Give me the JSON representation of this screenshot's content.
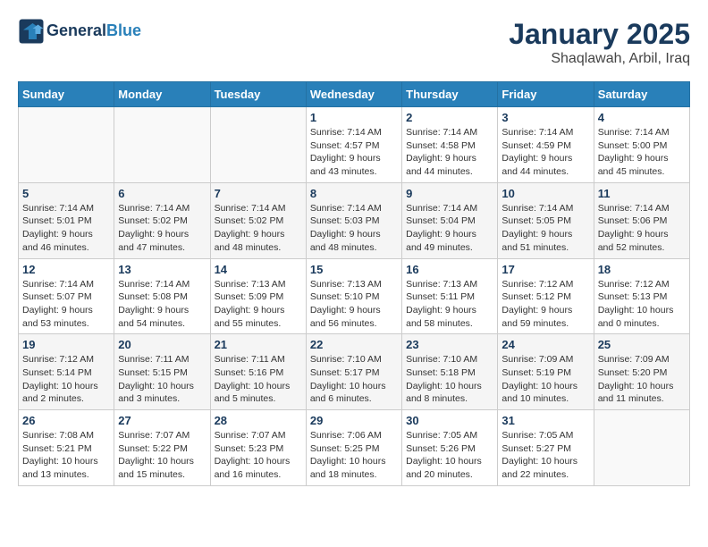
{
  "header": {
    "logo_line1": "General",
    "logo_line2": "Blue",
    "title": "January 2025",
    "subtitle": "Shaqlawah, Arbil, Iraq"
  },
  "weekdays": [
    "Sunday",
    "Monday",
    "Tuesday",
    "Wednesday",
    "Thursday",
    "Friday",
    "Saturday"
  ],
  "weeks": [
    [
      {
        "day": "",
        "info": ""
      },
      {
        "day": "",
        "info": ""
      },
      {
        "day": "",
        "info": ""
      },
      {
        "day": "1",
        "info": "Sunrise: 7:14 AM\nSunset: 4:57 PM\nDaylight: 9 hours and 43 minutes."
      },
      {
        "day": "2",
        "info": "Sunrise: 7:14 AM\nSunset: 4:58 PM\nDaylight: 9 hours and 44 minutes."
      },
      {
        "day": "3",
        "info": "Sunrise: 7:14 AM\nSunset: 4:59 PM\nDaylight: 9 hours and 44 minutes."
      },
      {
        "day": "4",
        "info": "Sunrise: 7:14 AM\nSunset: 5:00 PM\nDaylight: 9 hours and 45 minutes."
      }
    ],
    [
      {
        "day": "5",
        "info": "Sunrise: 7:14 AM\nSunset: 5:01 PM\nDaylight: 9 hours and 46 minutes."
      },
      {
        "day": "6",
        "info": "Sunrise: 7:14 AM\nSunset: 5:02 PM\nDaylight: 9 hours and 47 minutes."
      },
      {
        "day": "7",
        "info": "Sunrise: 7:14 AM\nSunset: 5:02 PM\nDaylight: 9 hours and 48 minutes."
      },
      {
        "day": "8",
        "info": "Sunrise: 7:14 AM\nSunset: 5:03 PM\nDaylight: 9 hours and 48 minutes."
      },
      {
        "day": "9",
        "info": "Sunrise: 7:14 AM\nSunset: 5:04 PM\nDaylight: 9 hours and 49 minutes."
      },
      {
        "day": "10",
        "info": "Sunrise: 7:14 AM\nSunset: 5:05 PM\nDaylight: 9 hours and 51 minutes."
      },
      {
        "day": "11",
        "info": "Sunrise: 7:14 AM\nSunset: 5:06 PM\nDaylight: 9 hours and 52 minutes."
      }
    ],
    [
      {
        "day": "12",
        "info": "Sunrise: 7:14 AM\nSunset: 5:07 PM\nDaylight: 9 hours and 53 minutes."
      },
      {
        "day": "13",
        "info": "Sunrise: 7:14 AM\nSunset: 5:08 PM\nDaylight: 9 hours and 54 minutes."
      },
      {
        "day": "14",
        "info": "Sunrise: 7:13 AM\nSunset: 5:09 PM\nDaylight: 9 hours and 55 minutes."
      },
      {
        "day": "15",
        "info": "Sunrise: 7:13 AM\nSunset: 5:10 PM\nDaylight: 9 hours and 56 minutes."
      },
      {
        "day": "16",
        "info": "Sunrise: 7:13 AM\nSunset: 5:11 PM\nDaylight: 9 hours and 58 minutes."
      },
      {
        "day": "17",
        "info": "Sunrise: 7:12 AM\nSunset: 5:12 PM\nDaylight: 9 hours and 59 minutes."
      },
      {
        "day": "18",
        "info": "Sunrise: 7:12 AM\nSunset: 5:13 PM\nDaylight: 10 hours and 0 minutes."
      }
    ],
    [
      {
        "day": "19",
        "info": "Sunrise: 7:12 AM\nSunset: 5:14 PM\nDaylight: 10 hours and 2 minutes."
      },
      {
        "day": "20",
        "info": "Sunrise: 7:11 AM\nSunset: 5:15 PM\nDaylight: 10 hours and 3 minutes."
      },
      {
        "day": "21",
        "info": "Sunrise: 7:11 AM\nSunset: 5:16 PM\nDaylight: 10 hours and 5 minutes."
      },
      {
        "day": "22",
        "info": "Sunrise: 7:10 AM\nSunset: 5:17 PM\nDaylight: 10 hours and 6 minutes."
      },
      {
        "day": "23",
        "info": "Sunrise: 7:10 AM\nSunset: 5:18 PM\nDaylight: 10 hours and 8 minutes."
      },
      {
        "day": "24",
        "info": "Sunrise: 7:09 AM\nSunset: 5:19 PM\nDaylight: 10 hours and 10 minutes."
      },
      {
        "day": "25",
        "info": "Sunrise: 7:09 AM\nSunset: 5:20 PM\nDaylight: 10 hours and 11 minutes."
      }
    ],
    [
      {
        "day": "26",
        "info": "Sunrise: 7:08 AM\nSunset: 5:21 PM\nDaylight: 10 hours and 13 minutes."
      },
      {
        "day": "27",
        "info": "Sunrise: 7:07 AM\nSunset: 5:22 PM\nDaylight: 10 hours and 15 minutes."
      },
      {
        "day": "28",
        "info": "Sunrise: 7:07 AM\nSunset: 5:23 PM\nDaylight: 10 hours and 16 minutes."
      },
      {
        "day": "29",
        "info": "Sunrise: 7:06 AM\nSunset: 5:25 PM\nDaylight: 10 hours and 18 minutes."
      },
      {
        "day": "30",
        "info": "Sunrise: 7:05 AM\nSunset: 5:26 PM\nDaylight: 10 hours and 20 minutes."
      },
      {
        "day": "31",
        "info": "Sunrise: 7:05 AM\nSunset: 5:27 PM\nDaylight: 10 hours and 22 minutes."
      },
      {
        "day": "",
        "info": ""
      }
    ]
  ]
}
